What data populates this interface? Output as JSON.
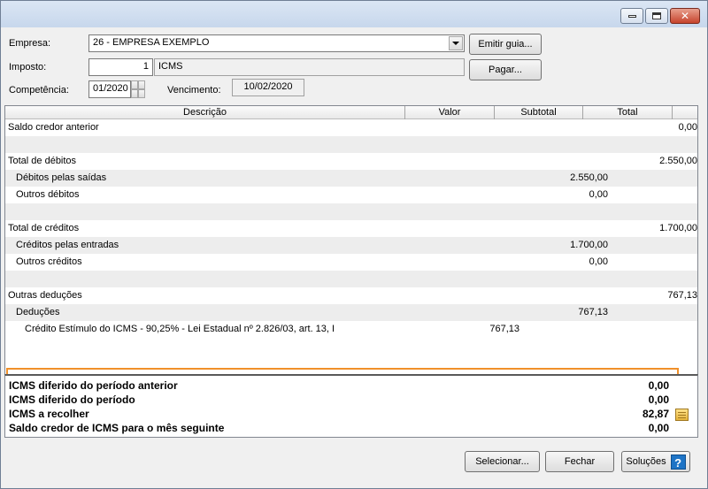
{
  "form": {
    "empresa_label": "Empresa:",
    "empresa_value": "26 - EMPRESA EXEMPLO",
    "imposto_label": "Imposto:",
    "imposto_code": "1",
    "imposto_name": "ICMS",
    "competencia_label": "Competência:",
    "competencia_value": "01/2020",
    "vencimento_label": "Vencimento:",
    "vencimento_value": "10/02/2020",
    "emitir_guia_label": "Emitir guia...",
    "pagar_label": "Pagar..."
  },
  "grid": {
    "columns": [
      "Descrição",
      "Valor",
      "Subtotal",
      "Total"
    ],
    "rows": [
      {
        "desc": "Saldo credor anterior",
        "indent": 0,
        "valor": "",
        "subtotal": "",
        "total": "0,00"
      },
      {
        "desc": "",
        "indent": 0,
        "valor": "",
        "subtotal": "",
        "total": ""
      },
      {
        "desc": "Total de débitos",
        "indent": 0,
        "valor": "",
        "subtotal": "",
        "total": "2.550,00"
      },
      {
        "desc": "Débitos pelas saídas",
        "indent": 1,
        "valor": "",
        "subtotal": "2.550,00",
        "total": ""
      },
      {
        "desc": "Outros débitos",
        "indent": 1,
        "valor": "",
        "subtotal": "0,00",
        "total": ""
      },
      {
        "desc": "",
        "indent": 0,
        "valor": "",
        "subtotal": "",
        "total": ""
      },
      {
        "desc": "Total de créditos",
        "indent": 0,
        "valor": "",
        "subtotal": "",
        "total": "1.700,00"
      },
      {
        "desc": "Créditos pelas entradas",
        "indent": 1,
        "valor": "",
        "subtotal": "1.700,00",
        "total": ""
      },
      {
        "desc": "Outros créditos",
        "indent": 1,
        "valor": "",
        "subtotal": "0,00",
        "total": ""
      },
      {
        "desc": "",
        "indent": 0,
        "valor": "",
        "subtotal": "",
        "total": ""
      },
      {
        "desc": "Outras deduções",
        "indent": 0,
        "valor": "",
        "subtotal": "",
        "total": "767,13"
      },
      {
        "desc": "Deduções",
        "indent": 1,
        "valor": "",
        "subtotal": "767,13",
        "total": ""
      },
      {
        "desc": "Crédito Estímulo do ICMS - 90,25% - Lei Estadual nº 2.826/03, art. 13, I",
        "indent": 2,
        "valor": "767,13",
        "subtotal": "",
        "total": ""
      }
    ]
  },
  "summary": [
    {
      "label": "ICMS diferido do período anterior",
      "value": "0,00"
    },
    {
      "label": "ICMS diferido do período",
      "value": "0,00"
    },
    {
      "label": "ICMS a recolher",
      "value": "82,87"
    },
    {
      "label": "Saldo credor de ICMS para o mês seguinte",
      "value": "0,00"
    }
  ],
  "buttons": {
    "selecionar": "Selecionar...",
    "fechar": "Fechar",
    "solucoes": "Soluções",
    "help_glyph": "?"
  },
  "icons": {
    "minimize": "minimize-icon",
    "maximize": "maximize-icon",
    "close": "close-icon",
    "note": "note-icon",
    "help": "help-icon"
  },
  "colors": {
    "highlight_border": "#f0902a",
    "help_blue": "#1e74c6"
  }
}
